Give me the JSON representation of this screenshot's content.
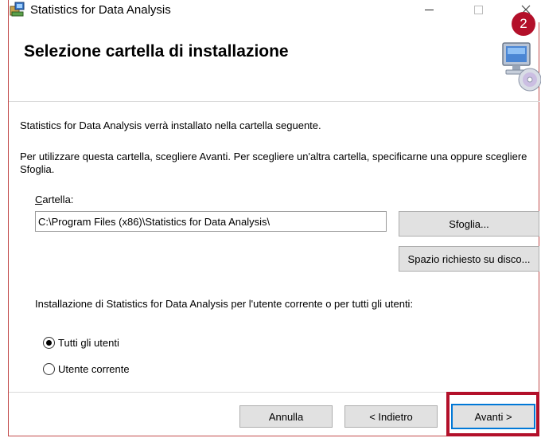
{
  "window": {
    "title": "Statistics for Data Analysis",
    "step_badge": "2"
  },
  "header": {
    "title": "Selezione cartella di installazione"
  },
  "body": {
    "intro": "Statistics for Data Analysis verrà installato nella cartella seguente.",
    "instructions": "Per utilizzare questa cartella, scegliere Avanti. Per scegliere un'altra cartella, specificarne una oppure scegliere Sfoglia.",
    "folder_label_accel": "C",
    "folder_label_rest": "artella:",
    "folder_value": "C:\\Program Files (x86)\\Statistics for Data Analysis\\",
    "browse_label": "Sfoglia...",
    "disk_space_label": "Spazio richiesto su disco...",
    "scope_text": "Installazione di Statistics for Data Analysis per l'utente corrente o per tutti gli utenti:",
    "radio_options": [
      {
        "label": "Tutti gli utenti",
        "selected": true
      },
      {
        "label": "Utente corrente",
        "selected": false
      }
    ]
  },
  "footer": {
    "cancel_label": "Annulla",
    "back_label": "< Indietro",
    "next_label": "Avanti >"
  },
  "colors": {
    "highlight": "#b3102a",
    "focus_border": "#0078d7",
    "button_face": "#e1e1e1"
  }
}
